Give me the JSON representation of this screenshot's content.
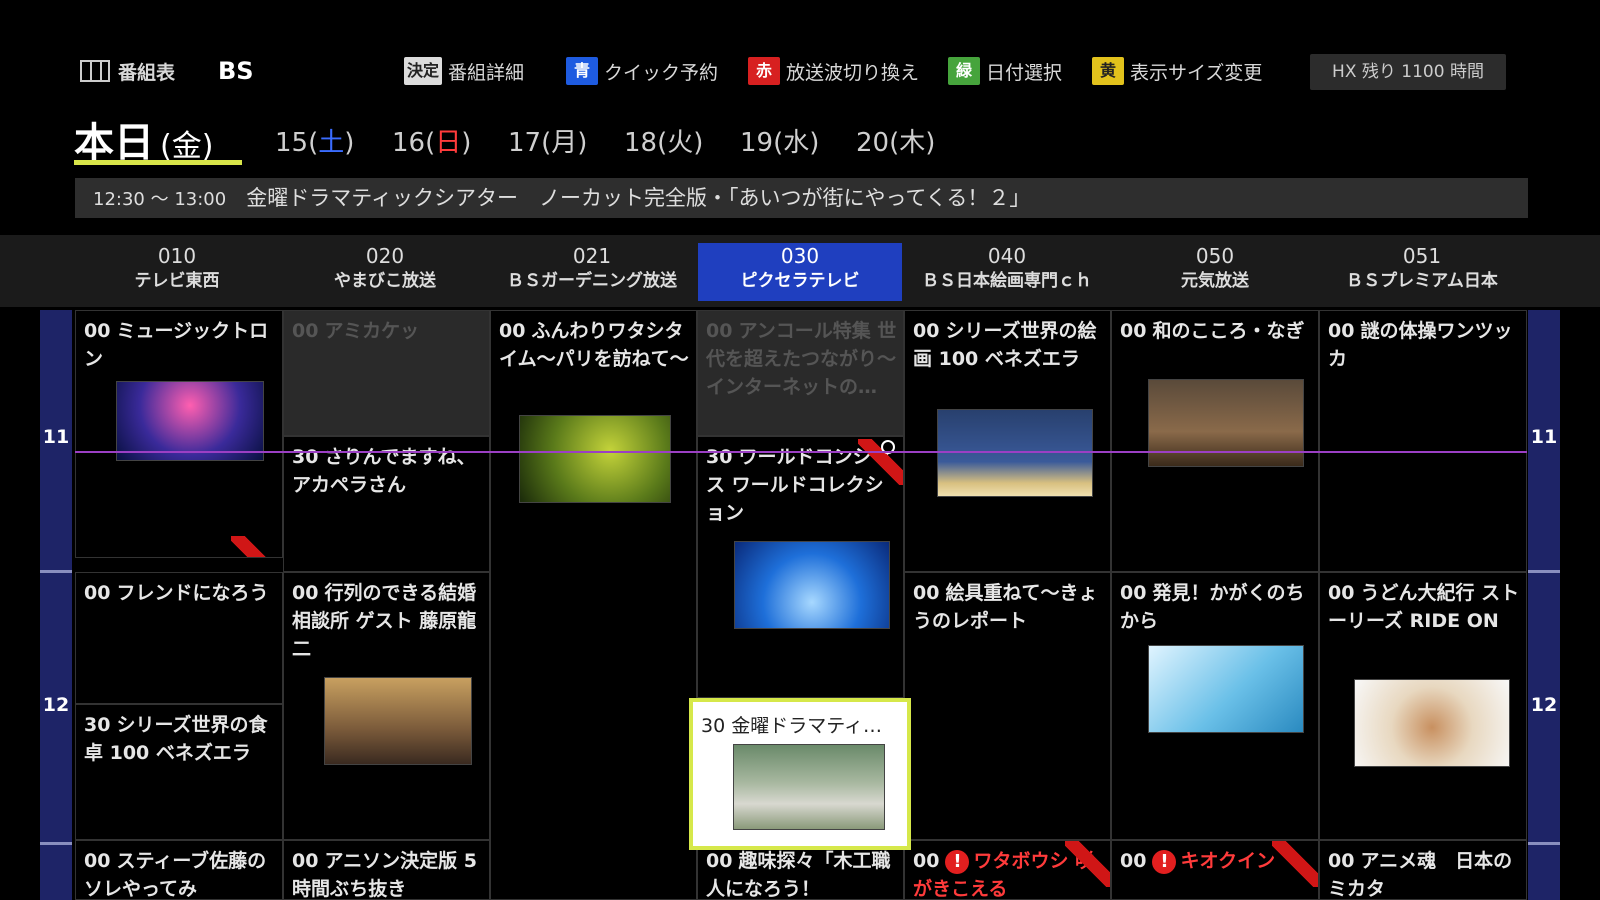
{
  "topbar": {
    "epg_label": "番組表",
    "band": "BS",
    "keys": [
      {
        "key": "決定",
        "label": "番組詳細",
        "color": "#dcdcdc"
      },
      {
        "key": "青",
        "label": "クイック予約",
        "color": "#1e5be0"
      },
      {
        "key": "赤",
        "label": "放送波切り換え",
        "color": "#d72020"
      },
      {
        "key": "緑",
        "label": "日付選択",
        "color": "#46a43c"
      },
      {
        "key": "黄",
        "label": "表示サイズ変更",
        "color": "#e2c21c"
      }
    ],
    "hdd_status": "HX 残り 1100 時間"
  },
  "dates": {
    "today": "本日",
    "today_dow": "(金)",
    "days": [
      {
        "day": "15",
        "dow": "土",
        "type": "sat"
      },
      {
        "day": "16",
        "dow": "日",
        "type": "sun"
      },
      {
        "day": "17",
        "dow": "月",
        "type": "weekday"
      },
      {
        "day": "18",
        "dow": "火",
        "type": "weekday"
      },
      {
        "day": "19",
        "dow": "水",
        "type": "weekday"
      },
      {
        "day": "20",
        "dow": "木",
        "type": "weekday"
      }
    ]
  },
  "infobar": {
    "time": "12:30 ～ 13:00",
    "title": "金曜ドラマティックシアター　ノーカット完全版・「あいつが街にやってくる！２」"
  },
  "channels": [
    {
      "num": "010",
      "name": "テレビ東西"
    },
    {
      "num": "020",
      "name": "やまびこ放送"
    },
    {
      "num": "021",
      "name": "ＢＳガーデニング放送"
    },
    {
      "num": "030",
      "name": "ピクセラテレビ",
      "selected": true
    },
    {
      "num": "040",
      "name": "ＢＳ日本絵画専門ｃｈ"
    },
    {
      "num": "050",
      "name": "元気放送"
    },
    {
      "num": "051",
      "name": "ＢＳプレミアム日本"
    }
  ],
  "hours": [
    "11",
    "12"
  ],
  "programs": {
    "c0a": {
      "min": "00",
      "title": "ミュージックトロン"
    },
    "c0b": {
      "min": "00",
      "title": "フレンドになろう"
    },
    "c0c": {
      "min": "30",
      "title": "シリーズ世界の食卓 100 ベネズエラ"
    },
    "c0d": {
      "min": "00",
      "title": "スティーブ佐藤のソレやってみ"
    },
    "c1a": {
      "min": "00",
      "title": "アミカケッ"
    },
    "c1b": {
      "min": "30",
      "title": "さりんでますね、アカペラさん"
    },
    "c1c": {
      "min": "00",
      "title": "行列のできる結婚相談所 ゲスト 藤原龍二"
    },
    "c1d": {
      "min": "00",
      "title": "アニソン決定版 5時間ぶち抜き"
    },
    "c2a": {
      "min": "00",
      "title": "ふんわりワタシタイム～パリを訪ねて～"
    },
    "c3a": {
      "min": "00",
      "title": "アンコール特集 世代を超えたつながり～インターネットの…"
    },
    "c3b": {
      "min": "30",
      "title": "ワールドコンシャス ワールドコレクション"
    },
    "c3c": {
      "min": "30",
      "title": "金曜ドラマティ…"
    },
    "c3d": {
      "min": "00",
      "title": "趣味探々「木工職人になろう！"
    },
    "c4a": {
      "min": "00",
      "title": "シリーズ世界の絵画 100 ベネズエラ"
    },
    "c4b": {
      "min": "00",
      "title": "絵具重ねて～きょうのレポート"
    },
    "c4c": {
      "min": "00",
      "title": "ワタボウシ 咲がきこえる"
    },
    "c5a": {
      "min": "00",
      "title": "和のこころ・なぎ"
    },
    "c5b": {
      "min": "00",
      "title": "発見！かがくのちから"
    },
    "c5c": {
      "min": "00",
      "title": "キオクイン"
    },
    "c6a": {
      "min": "00",
      "title": "謎の体操ワンツッカ"
    },
    "c6b": {
      "min": "00",
      "title": "うどん大紀行 ストーリーズ RIDE ON"
    },
    "c6c": {
      "min": "00",
      "title": "アニメ魂　日本のミカタ"
    }
  }
}
